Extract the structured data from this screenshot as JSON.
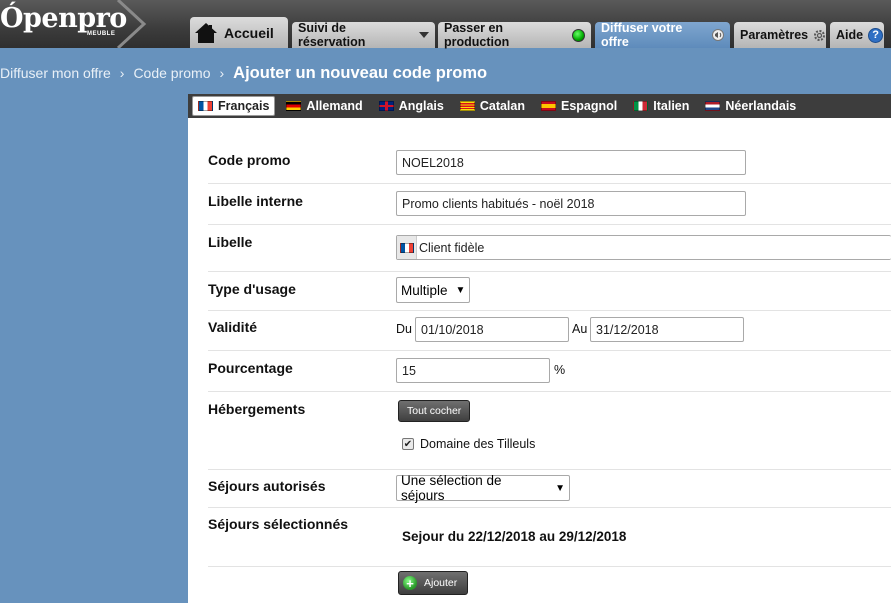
{
  "header": {
    "logo_text": "Ópenpro",
    "logo_subtext": "MEUBLE",
    "tabs": [
      {
        "label": "Accueil"
      },
      {
        "label": "Suivi de réservation"
      },
      {
        "label": "Passer en production"
      },
      {
        "label": "Diffuser votre offre"
      },
      {
        "label": "Paramètres"
      },
      {
        "label": "Aide"
      }
    ]
  },
  "breadcrumb": {
    "items": [
      "Diffuser mon offre",
      "Code promo"
    ],
    "separator": "›",
    "current": "Ajouter un nouveau code promo"
  },
  "languages": [
    {
      "label": "Français",
      "flag": "fr"
    },
    {
      "label": "Allemand",
      "flag": "de"
    },
    {
      "label": "Anglais",
      "flag": "gb"
    },
    {
      "label": "Catalan",
      "flag": "ca"
    },
    {
      "label": "Espagnol",
      "flag": "es"
    },
    {
      "label": "Italien",
      "flag": "it"
    },
    {
      "label": "Néerlandais",
      "flag": "nl"
    }
  ],
  "form": {
    "code": {
      "label": "Code promo",
      "value": "NOEL2018"
    },
    "internal_label": {
      "label": "Libelle interne",
      "value": "Promo clients habitués - noël 2018"
    },
    "libelle": {
      "label": "Libelle",
      "value": "Client fidèle"
    },
    "usage_type": {
      "label": "Type d'usage",
      "value": "Multiple"
    },
    "validity": {
      "label": "Validité",
      "from_label": "Du",
      "from_value": "01/10/2018",
      "to_label": "Au",
      "to_value": "31/12/2018"
    },
    "percentage": {
      "label": "Pourcentage",
      "value": "15",
      "unit": "%"
    },
    "accommodations": {
      "label": "Hébergements",
      "check_all_label": "Tout cocher",
      "items": [
        {
          "label": "Domaine des Tilleuls",
          "checked": true
        }
      ]
    },
    "allowed_stays": {
      "label": "Séjours autorisés",
      "value": "Une sélection de séjours"
    },
    "selected_stays": {
      "label": "Séjours sélectionnés",
      "value": "Sejour du 22/12/2018 au 29/12/2018"
    },
    "add_button_label": "Ajouter"
  },
  "colors": {
    "background_blue": "#6792bd",
    "active_tab": "#6c98c6",
    "topbar": "#3c3c3c",
    "language_bar": "#3d3d3d"
  }
}
